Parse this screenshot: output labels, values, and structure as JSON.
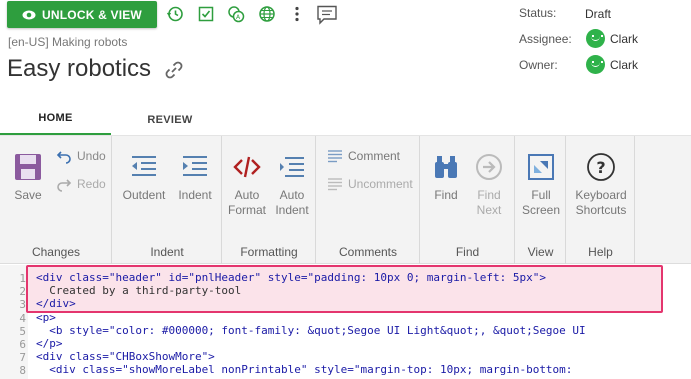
{
  "toolbar": {
    "unlock_label": "UNLOCK & VIEW",
    "icons": [
      "history-icon",
      "checklist-icon",
      "translate-icon",
      "globe-icon",
      "more-vert-icon",
      "comment-icon"
    ]
  },
  "meta": {
    "status_label": "Status:",
    "status_value": "Draft",
    "assignee_label": "Assignee:",
    "assignee_name": "Clark",
    "owner_label": "Owner:",
    "owner_name": "Clark"
  },
  "document": {
    "locale_line": "[en-US] Making robots",
    "title": "Easy robotics"
  },
  "tabs": [
    {
      "label": "HOME",
      "active": true
    },
    {
      "label": "REVIEW",
      "active": false
    }
  ],
  "ribbon": {
    "changes": {
      "save": "Save",
      "undo": "Undo",
      "redo": "Redo",
      "label": "Changes"
    },
    "indent": {
      "outdent": "Outdent",
      "indent": "Indent",
      "label": "Indent"
    },
    "formatting": {
      "auto_format_1": "Auto",
      "auto_format_2": "Format",
      "auto_indent_1": "Auto",
      "auto_indent_2": "Indent",
      "label": "Formatting"
    },
    "comments": {
      "comment": "Comment",
      "uncomment": "Uncomment",
      "label": "Comments"
    },
    "find": {
      "find": "Find",
      "find_next_1": "Find",
      "find_next_2": "Next",
      "label": "Find"
    },
    "view": {
      "full_1": "Full",
      "full_2": "Screen",
      "label": "View"
    },
    "help": {
      "kb_1": "Keyboard",
      "kb_2": "Shortcuts",
      "label": "Help"
    }
  },
  "editor": {
    "line_numbers": [
      "1",
      "2",
      "3",
      "4",
      "5",
      "6",
      "7",
      "8"
    ],
    "lines": [
      "<div class=\"header\" id=\"pnlHeader\" style=\"padding: 10px 0; margin-left: 5px\">",
      "  Created by a third-party-tool",
      "</div>",
      "<p>",
      "  <b style=\"color: #000000; font-family: &quot;Segoe UI Light&quot;, &quot;Segoe UI",
      "</p>",
      "<div class=\"CHBoxShowMore\">",
      "  <div class=\"showMoreLabel nonPrintable\" style=\"margin-top: 10px; margin-bottom:"
    ]
  },
  "colors": {
    "accent_green": "#2e9e3e",
    "highlight_border": "#e4356e",
    "highlight_fill": "#fbe3ea"
  }
}
